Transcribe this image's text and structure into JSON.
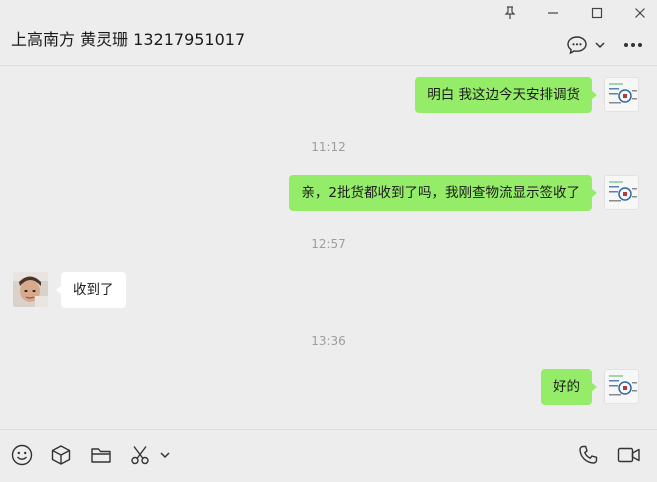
{
  "header": {
    "title": "上高南方 黄灵珊 13217951017"
  },
  "window_controls": [
    "pin-icon",
    "minimize-icon",
    "maximize-icon",
    "close-icon"
  ],
  "messages": [
    {
      "sender": "me",
      "text": "明白 我这边今天安排调货"
    },
    {
      "time": "11:12"
    },
    {
      "sender": "me",
      "text": "亲，2批货都收到了吗，我刚查物流显示签收了"
    },
    {
      "time": "12:57"
    },
    {
      "sender": "them",
      "text": "收到了"
    },
    {
      "time": "13:36"
    },
    {
      "sender": "me",
      "text": "好的"
    }
  ],
  "toolbar": {
    "left": [
      "emoji-icon",
      "box-icon",
      "folder-icon",
      "scissors-icon",
      "chevron-down-icon"
    ],
    "right": [
      "phone-icon",
      "video-icon"
    ]
  },
  "colors": {
    "background": "#ededed",
    "my_bubble": "#95ec69",
    "their_bubble": "#ffffff",
    "timestamp": "#9d9d9d"
  }
}
